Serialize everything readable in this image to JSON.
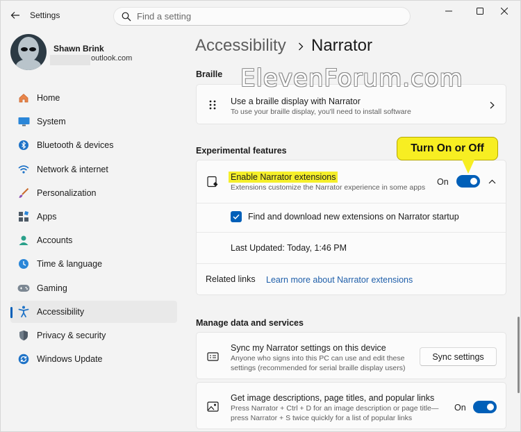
{
  "window": {
    "title": "Settings"
  },
  "search": {
    "placeholder": "Find a setting"
  },
  "profile": {
    "name": "Shawn Brink",
    "email_suffix": "outlook.com"
  },
  "sidebar": {
    "items": [
      {
        "label": "Home",
        "icon": "home-icon",
        "active": false
      },
      {
        "label": "System",
        "icon": "monitor-icon",
        "active": false
      },
      {
        "label": "Bluetooth & devices",
        "icon": "bluetooth-icon",
        "active": false
      },
      {
        "label": "Network & internet",
        "icon": "wifi-icon",
        "active": false
      },
      {
        "label": "Personalization",
        "icon": "brush-icon",
        "active": false
      },
      {
        "label": "Apps",
        "icon": "apps-icon",
        "active": false
      },
      {
        "label": "Accounts",
        "icon": "person-icon",
        "active": false
      },
      {
        "label": "Time & language",
        "icon": "clock-globe-icon",
        "active": false
      },
      {
        "label": "Gaming",
        "icon": "gamepad-icon",
        "active": false
      },
      {
        "label": "Accessibility",
        "icon": "accessibility-icon",
        "active": true
      },
      {
        "label": "Privacy & security",
        "icon": "shield-icon",
        "active": false
      },
      {
        "label": "Windows Update",
        "icon": "update-icon",
        "active": false
      }
    ]
  },
  "breadcrumb": {
    "parent": "Accessibility",
    "current": "Narrator"
  },
  "braille": {
    "section_title": "Braille",
    "title": "Use a braille display with Narrator",
    "desc": "To use your braille display, you'll need to install software"
  },
  "experimental": {
    "section_title": "Experimental features",
    "title": "Enable Narrator extensions",
    "desc": "Extensions customize the Narrator experience in some apps",
    "toggle_label": "On",
    "toggle_on": true,
    "checkbox_label": "Find and download new extensions on Narrator startup",
    "checkbox_checked": true,
    "last_updated": "Last Updated: Today, 1:46 PM",
    "related_label": "Related links",
    "related_link": "Learn more about Narrator extensions"
  },
  "manage": {
    "section_title": "Manage data and services",
    "sync_title": "Sync my Narrator settings on this device",
    "sync_desc_1": "Anyone who signs into this PC can use and edit these",
    "sync_desc_2": "settings (recommended for serial braille display users)",
    "sync_button": "Sync settings",
    "img_title": "Get image descriptions, page titles, and popular links",
    "img_desc_1": "Press Narrator + Ctrl + D for an image description or page title—",
    "img_desc_2": "press Narrator + S twice quickly for a list of popular links",
    "img_toggle_label": "On",
    "img_toggle_on": true
  },
  "annotations": {
    "watermark": "ElevenForum.com",
    "callout": "Turn On or Off"
  },
  "colors": {
    "accent": "#005fb8",
    "highlight": "#f5ef2a"
  }
}
